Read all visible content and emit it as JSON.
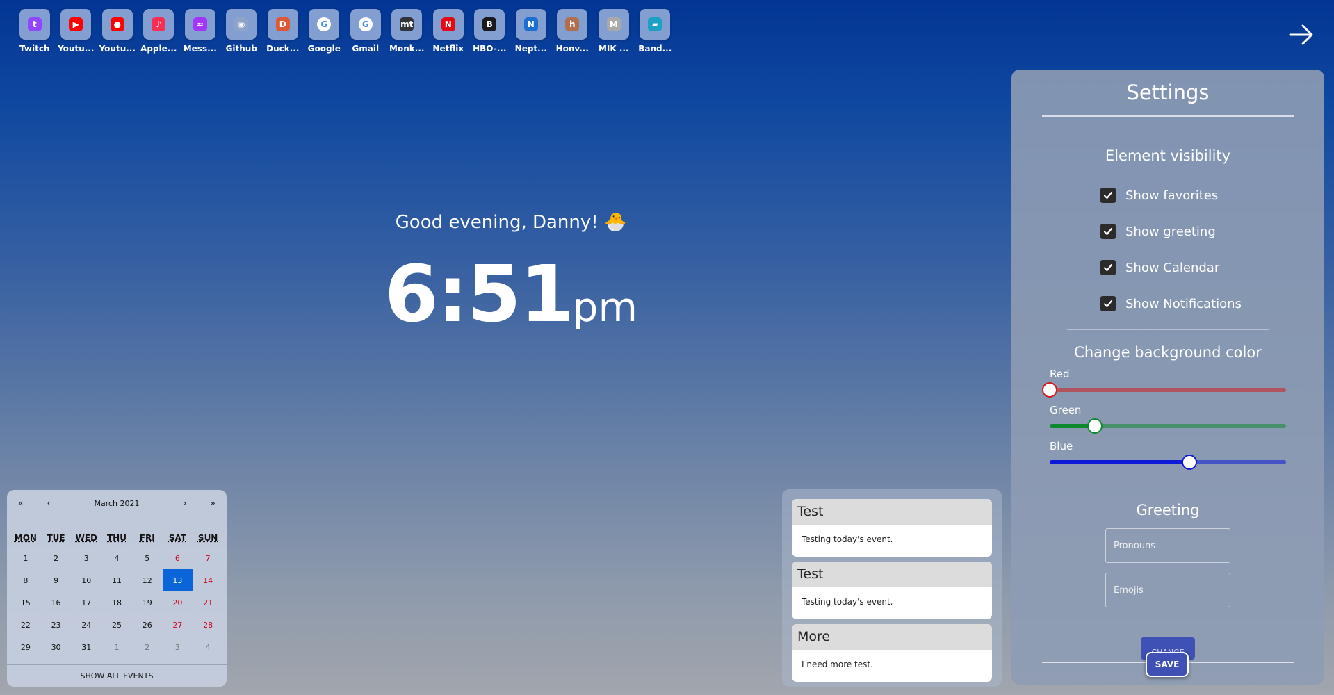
{
  "favorites": [
    {
      "label": "Twitch",
      "icon": "twitch-icon",
      "color": "#9146ff",
      "glyph": "t"
    },
    {
      "label": "Youtu...",
      "icon": "youtube-icon",
      "color": "#ff0000",
      "glyph": "▶"
    },
    {
      "label": "Youtu...",
      "icon": "youtube-music-icon",
      "color": "#ff0000",
      "glyph": "●"
    },
    {
      "label": "Apple...",
      "icon": "apple-music-icon",
      "color": "#fa2d55",
      "glyph": "♪"
    },
    {
      "label": "Mess...",
      "icon": "messenger-icon",
      "color": "#a334fa",
      "glyph": "≈"
    },
    {
      "label": "Github",
      "icon": "globe-icon",
      "color": "#8fa2c8",
      "glyph": "◉"
    },
    {
      "label": "Duck...",
      "icon": "duckduckgo-icon",
      "color": "#de5833",
      "glyph": "D"
    },
    {
      "label": "Google",
      "icon": "google-icon",
      "color": "#ffffff",
      "glyph": "G"
    },
    {
      "label": "Gmail",
      "icon": "google-icon",
      "color": "#ffffff",
      "glyph": "G"
    },
    {
      "label": "Monk...",
      "icon": "monkeytype-icon",
      "color": "#323437",
      "glyph": "mt"
    },
    {
      "label": "Netflix",
      "icon": "netflix-icon",
      "color": "#e50914",
      "glyph": "N"
    },
    {
      "label": "HBO-...",
      "icon": "hbo-icon",
      "color": "#1a1a1a",
      "glyph": "B"
    },
    {
      "label": "Nept...",
      "icon": "neptun-icon",
      "color": "#1c6ed1",
      "glyph": "N"
    },
    {
      "label": "Honv...",
      "icon": "honved-icon",
      "color": "#b07050",
      "glyph": "h"
    },
    {
      "label": "MIK ...",
      "icon": "mik-icon",
      "color": "#aaaaaa",
      "glyph": "M"
    },
    {
      "label": "Band...",
      "icon": "bandcamp-icon",
      "color": "#1da0c3",
      "glyph": "▰"
    }
  ],
  "greeting": {
    "text": "Good evening, Danny! 🐣"
  },
  "clock": {
    "time": "6:51",
    "ampm": "pm"
  },
  "calendar": {
    "month_label": "March 2021",
    "nav": {
      "first": "«",
      "prev": "‹",
      "next": "›",
      "last": "»"
    },
    "weekdays": [
      "MON",
      "TUE",
      "WED",
      "THU",
      "FRI",
      "SAT",
      "SUN"
    ],
    "days": [
      {
        "d": "1",
        "t": ""
      },
      {
        "d": "2",
        "t": ""
      },
      {
        "d": "3",
        "t": ""
      },
      {
        "d": "4",
        "t": ""
      },
      {
        "d": "5",
        "t": ""
      },
      {
        "d": "6",
        "t": "weekend"
      },
      {
        "d": "7",
        "t": "weekend"
      },
      {
        "d": "8",
        "t": ""
      },
      {
        "d": "9",
        "t": ""
      },
      {
        "d": "10",
        "t": ""
      },
      {
        "d": "11",
        "t": ""
      },
      {
        "d": "12",
        "t": ""
      },
      {
        "d": "13",
        "t": "today"
      },
      {
        "d": "14",
        "t": "weekend"
      },
      {
        "d": "15",
        "t": ""
      },
      {
        "d": "16",
        "t": ""
      },
      {
        "d": "17",
        "t": ""
      },
      {
        "d": "18",
        "t": ""
      },
      {
        "d": "19",
        "t": ""
      },
      {
        "d": "20",
        "t": "weekend"
      },
      {
        "d": "21",
        "t": "weekend"
      },
      {
        "d": "22",
        "t": ""
      },
      {
        "d": "23",
        "t": ""
      },
      {
        "d": "24",
        "t": ""
      },
      {
        "d": "25",
        "t": ""
      },
      {
        "d": "26",
        "t": ""
      },
      {
        "d": "27",
        "t": "weekend"
      },
      {
        "d": "28",
        "t": "weekend"
      },
      {
        "d": "29",
        "t": ""
      },
      {
        "d": "30",
        "t": ""
      },
      {
        "d": "31",
        "t": ""
      },
      {
        "d": "1",
        "t": "other"
      },
      {
        "d": "2",
        "t": "other"
      },
      {
        "d": "3",
        "t": "other"
      },
      {
        "d": "4",
        "t": "other"
      }
    ],
    "footer": "SHOW ALL EVENTS"
  },
  "notifications": [
    {
      "title": "Test",
      "body": "Testing today's event."
    },
    {
      "title": "Test",
      "body": "Testing today's event."
    },
    {
      "title": "More",
      "body": "I need more test."
    }
  ],
  "settings": {
    "title": "Settings",
    "visibility_title": "Element visibility",
    "checks": [
      {
        "label": "Show favorites",
        "checked": true
      },
      {
        "label": "Show greeting",
        "checked": true
      },
      {
        "label": "Show Calendar",
        "checked": true
      },
      {
        "label": "Show Notifications",
        "checked": true
      }
    ],
    "bg_title": "Change background color",
    "sliders": [
      {
        "label": "Red",
        "value": 0,
        "color": "#d01c1c"
      },
      {
        "label": "Green",
        "value": 0.19,
        "color": "#0e8a2e"
      },
      {
        "label": "Blue",
        "value": 0.59,
        "color": "#0f1ad8"
      }
    ],
    "greeting_title": "Greeting",
    "pronouns_placeholder": "Pronouns",
    "emojis_placeholder": "Emojis",
    "change_label": "CHANGE",
    "save_label": "SAVE"
  }
}
